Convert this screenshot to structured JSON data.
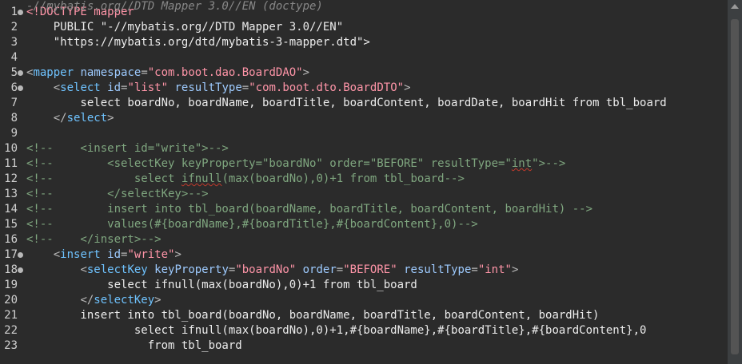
{
  "hover_text": "-//mybatis.org//DTD Mapper 3.0//EN (doctype)",
  "lines": [
    {
      "num": "1",
      "fold": true,
      "tokens": [
        {
          "c": "t-doctype",
          "t": "<!DOCTYPE mapper"
        }
      ]
    },
    {
      "num": "2",
      "fold": false,
      "tokens": [
        {
          "c": "t-text",
          "t": "    PUBLIC \"-//mybatis.org//DTD Mapper 3.0//EN\""
        }
      ]
    },
    {
      "num": "3",
      "fold": false,
      "tokens": [
        {
          "c": "t-text",
          "t": "    \"https://mybatis.org/dtd/mybatis-3-mapper.dtd\">"
        }
      ]
    },
    {
      "num": "4",
      "fold": false,
      "tokens": []
    },
    {
      "num": "5",
      "fold": true,
      "tokens": [
        {
          "c": "t-punct",
          "t": "<"
        },
        {
          "c": "t-tag",
          "t": "mapper"
        },
        {
          "c": "t-text",
          "t": " "
        },
        {
          "c": "t-attr",
          "t": "namespace"
        },
        {
          "c": "t-punct",
          "t": "="
        },
        {
          "c": "t-val",
          "t": "\"com.boot.dao.BoardDAO\""
        },
        {
          "c": "t-punct",
          "t": ">"
        }
      ]
    },
    {
      "num": "6",
      "fold": true,
      "tokens": [
        {
          "c": "t-text",
          "t": "    "
        },
        {
          "c": "t-punct",
          "t": "<"
        },
        {
          "c": "t-tag",
          "t": "select"
        },
        {
          "c": "t-text",
          "t": " "
        },
        {
          "c": "t-attr",
          "t": "id"
        },
        {
          "c": "t-punct",
          "t": "="
        },
        {
          "c": "t-val",
          "t": "\"list\""
        },
        {
          "c": "t-text",
          "t": " "
        },
        {
          "c": "t-attr",
          "t": "resultType"
        },
        {
          "c": "t-punct",
          "t": "="
        },
        {
          "c": "t-val",
          "t": "\"com.boot.dto.BoardDTO\""
        },
        {
          "c": "t-punct",
          "t": ">"
        }
      ]
    },
    {
      "num": "7",
      "fold": false,
      "tokens": [
        {
          "c": "t-text",
          "t": "        select boardNo, boardName, boardTitle, boardContent, boardDate, boardHit from tbl_board"
        }
      ]
    },
    {
      "num": "8",
      "fold": false,
      "tokens": [
        {
          "c": "t-text",
          "t": "    "
        },
        {
          "c": "t-punct",
          "t": "</"
        },
        {
          "c": "t-tag",
          "t": "select"
        },
        {
          "c": "t-punct",
          "t": ">"
        }
      ]
    },
    {
      "num": "9",
      "fold": false,
      "tokens": []
    },
    {
      "num": "10",
      "fold": false,
      "tokens": [
        {
          "c": "t-comment",
          "t": "<!--    <insert id=\"write\">-->"
        }
      ]
    },
    {
      "num": "11",
      "fold": false,
      "tokens": [
        {
          "c": "t-comment",
          "t": "<!--        <selectKey keyProperty=\"boardNo\" order=\"BEFORE\" resultType=\""
        },
        {
          "c": "t-comment squiggle",
          "t": "int"
        },
        {
          "c": "t-comment",
          "t": "\">-->"
        }
      ]
    },
    {
      "num": "12",
      "fold": false,
      "tokens": [
        {
          "c": "t-comment",
          "t": "<!--            select "
        },
        {
          "c": "t-comment squiggle",
          "t": "ifnull"
        },
        {
          "c": "t-comment",
          "t": "(max(boardNo),0)+1 from tbl_board-->"
        }
      ]
    },
    {
      "num": "13",
      "fold": false,
      "tokens": [
        {
          "c": "t-comment",
          "t": "<!--        </selectKey>-->"
        }
      ]
    },
    {
      "num": "14",
      "fold": false,
      "tokens": [
        {
          "c": "t-comment",
          "t": "<!--        insert into tbl_board(boardName, boardTitle, boardContent, boardHit) -->"
        }
      ]
    },
    {
      "num": "15",
      "fold": false,
      "tokens": [
        {
          "c": "t-comment",
          "t": "<!--        values(#{boardName},#{boardTitle},#{boardContent},0)-->"
        }
      ]
    },
    {
      "num": "16",
      "fold": false,
      "tokens": [
        {
          "c": "t-comment",
          "t": "<!--    </insert>-->"
        }
      ]
    },
    {
      "num": "17",
      "fold": true,
      "tokens": [
        {
          "c": "t-text",
          "t": "    "
        },
        {
          "c": "t-punct",
          "t": "<"
        },
        {
          "c": "t-tag",
          "t": "insert"
        },
        {
          "c": "t-text",
          "t": " "
        },
        {
          "c": "t-attr",
          "t": "id"
        },
        {
          "c": "t-punct",
          "t": "="
        },
        {
          "c": "t-val",
          "t": "\"write\""
        },
        {
          "c": "t-punct",
          "t": ">"
        }
      ]
    },
    {
      "num": "18",
      "fold": true,
      "tokens": [
        {
          "c": "t-text",
          "t": "        "
        },
        {
          "c": "t-punct",
          "t": "<"
        },
        {
          "c": "t-tag",
          "t": "selectKey"
        },
        {
          "c": "t-text",
          "t": " "
        },
        {
          "c": "t-attr",
          "t": "keyProperty"
        },
        {
          "c": "t-punct",
          "t": "="
        },
        {
          "c": "t-val",
          "t": "\"boardNo\""
        },
        {
          "c": "t-text",
          "t": " "
        },
        {
          "c": "t-attr",
          "t": "order"
        },
        {
          "c": "t-punct",
          "t": "="
        },
        {
          "c": "t-val",
          "t": "\"BEFORE\""
        },
        {
          "c": "t-text",
          "t": " "
        },
        {
          "c": "t-attr",
          "t": "resultType"
        },
        {
          "c": "t-punct",
          "t": "="
        },
        {
          "c": "t-val",
          "t": "\"int\""
        },
        {
          "c": "t-punct",
          "t": ">"
        }
      ]
    },
    {
      "num": "19",
      "fold": false,
      "tokens": [
        {
          "c": "t-text",
          "t": "            select ifnull(max(boardNo),0)+1 from tbl_board"
        }
      ]
    },
    {
      "num": "20",
      "fold": false,
      "tokens": [
        {
          "c": "t-text",
          "t": "        "
        },
        {
          "c": "t-punct",
          "t": "</"
        },
        {
          "c": "t-tag",
          "t": "selectKey"
        },
        {
          "c": "t-punct",
          "t": ">"
        }
      ]
    },
    {
      "num": "21",
      "fold": false,
      "tokens": [
        {
          "c": "t-text",
          "t": "        insert into tbl_board(boardNo, boardName, boardTitle, boardContent, boardHit)"
        }
      ]
    },
    {
      "num": "22",
      "fold": false,
      "tokens": [
        {
          "c": "t-text",
          "t": "                select ifnull(max(boardNo),0)+1,#{boardName},#{boardTitle},#{boardContent},0"
        }
      ]
    },
    {
      "num": "23",
      "fold": false,
      "tokens": [
        {
          "c": "t-text",
          "t": "                  from tbl_board"
        }
      ]
    }
  ]
}
